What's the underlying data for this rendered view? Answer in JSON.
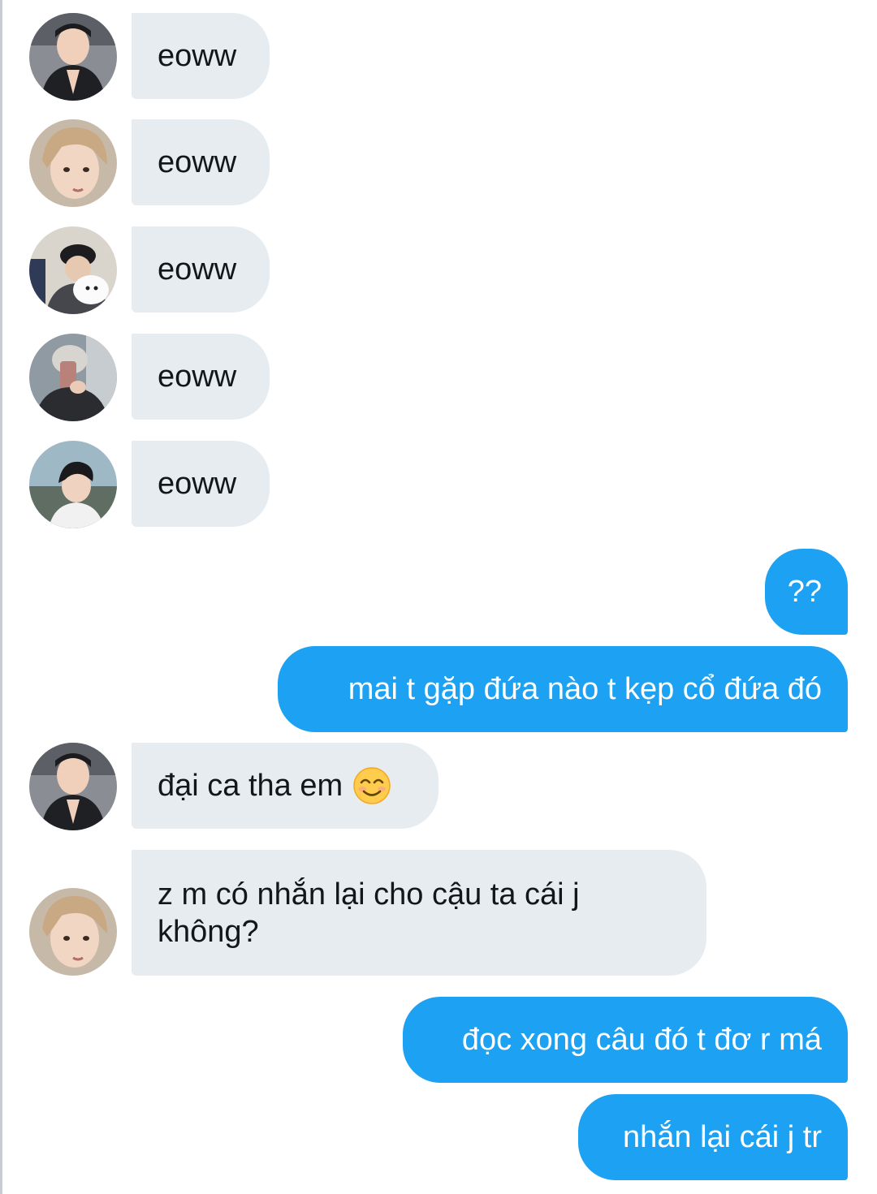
{
  "conversation": {
    "messages": [
      {
        "text": "eoww",
        "direction": "incoming",
        "avatar": "avatar-boy-praying-hands"
      },
      {
        "text": "eoww",
        "direction": "incoming",
        "avatar": "avatar-blond-boy-portrait"
      },
      {
        "text": "eoww",
        "direction": "incoming",
        "avatar": "avatar-cap-boy-with-dog"
      },
      {
        "text": "eoww",
        "direction": "incoming",
        "avatar": "avatar-boy-phone-selfie"
      },
      {
        "text": "eoww",
        "direction": "incoming",
        "avatar": "avatar-boy-outdoor-sky"
      },
      {
        "text": "??",
        "direction": "outgoing"
      },
      {
        "text": "mai t gặp đứa nào t kẹp cổ đứa đó",
        "direction": "outgoing"
      },
      {
        "text": "đại ca tha em",
        "direction": "incoming",
        "avatar": "avatar-boy-praying-hands",
        "emoji": "smiling-face-emoji"
      },
      {
        "text": "z m có nhắn lại cho cậu ta cái j không?",
        "direction": "incoming",
        "avatar": "avatar-blond-boy-portrait"
      },
      {
        "text": "đọc xong câu đó t đơ r má",
        "direction": "outgoing"
      },
      {
        "text": "nhắn lại cái j tr",
        "direction": "outgoing"
      }
    ]
  },
  "colors": {
    "incoming_bubble": "#e6ecf0",
    "outgoing_bubble": "#1da1f2",
    "incoming_text": "#14171a",
    "outgoing_text": "#ffffff"
  }
}
